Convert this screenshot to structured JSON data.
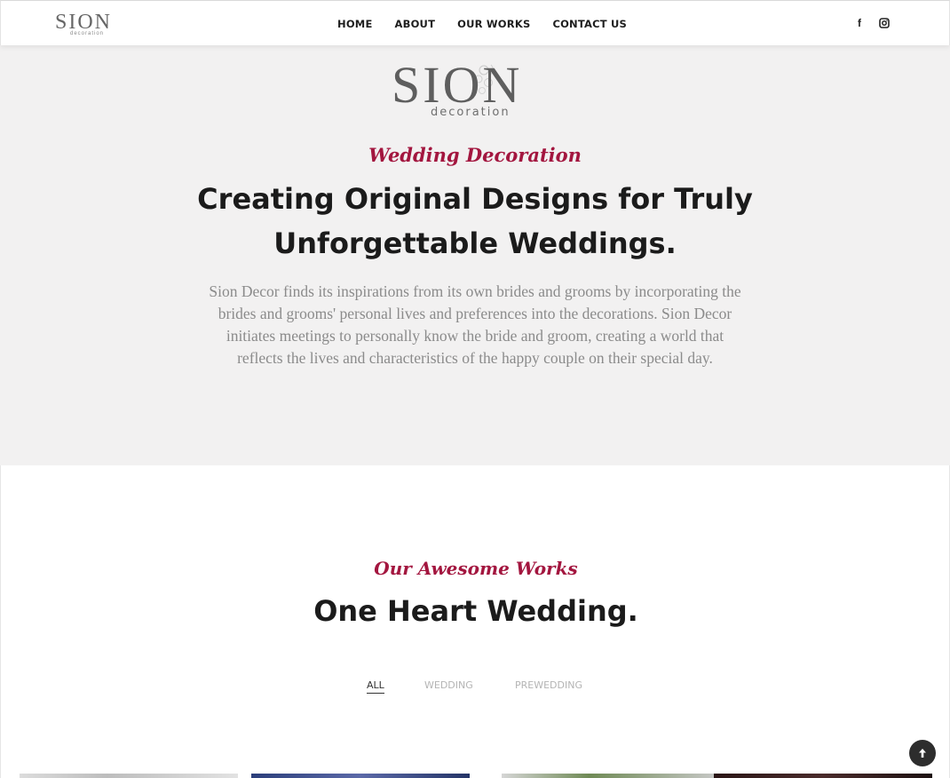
{
  "header": {
    "logo_text": "SION",
    "logo_sub": "decoration",
    "nav": [
      "HOME",
      "ABOUT",
      "OUR WORKS",
      "CONTACT US"
    ],
    "social": {
      "facebook_icon": "facebook-icon",
      "facebook_glyph": "f",
      "instagram_icon": "instagram-icon"
    }
  },
  "hero": {
    "logo_text": "SION",
    "logo_sub": "decoration",
    "kicker": "Wedding Decoration",
    "title": "Creating Original Designs for Truly Unforgettable Weddings.",
    "description": "Sion Decor finds its inspirations from its own brides and grooms by incorporating the brides and grooms' personal lives and preferences into the decorations. Sion Decor initiates meetings to personally know the bride and groom, creating a world that reflects the lives and characteristics of the happy couple on their special day."
  },
  "works": {
    "kicker": "Our Awesome Works",
    "title": "One Heart Wedding.",
    "filters": [
      "ALL",
      "WEDDING",
      "PREWEDDING"
    ],
    "active_filter": "ALL"
  },
  "scroll_top": {
    "icon": "arrow-up-icon"
  },
  "colors": {
    "accent": "#a3163f",
    "hero_bg": "#f2f1f1",
    "heading": "#1b1b1b",
    "body_text": "#8b8b8b"
  }
}
